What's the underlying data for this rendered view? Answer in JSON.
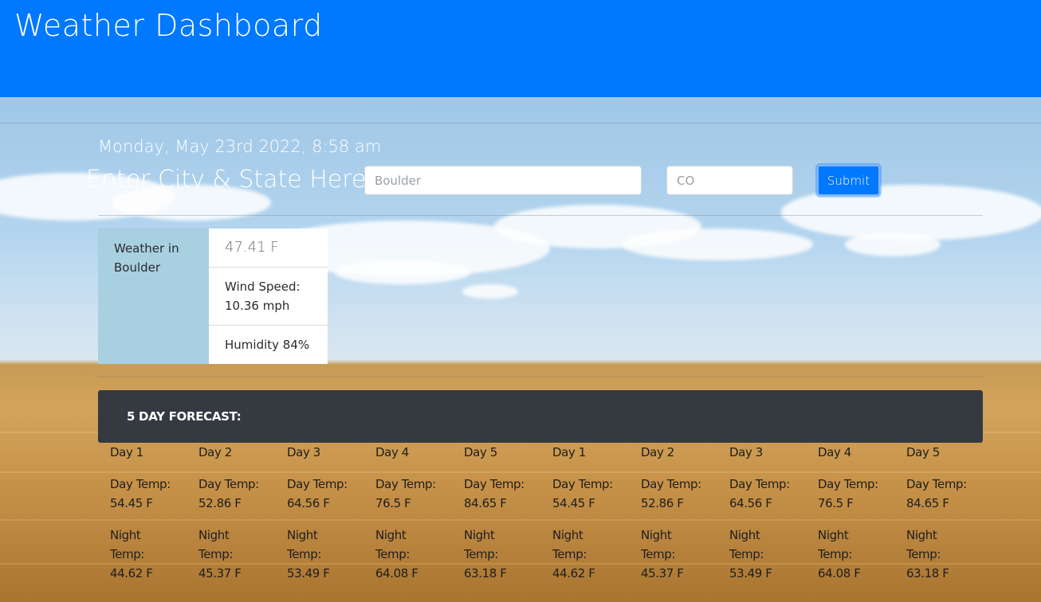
{
  "header": {
    "title": "Weather Dashboard"
  },
  "datetime": "Monday, May 23rd 2022, 8:58 am",
  "search": {
    "prompt": "Enter City & State Here:",
    "city_placeholder": "Boulder",
    "state_placeholder": "CO",
    "submit_label": "Submit"
  },
  "current": {
    "label": "Weather in Boulder",
    "temp": "47.41 F",
    "wind": "Wind Speed: 10.36 mph",
    "humidity": "Humidity 84%"
  },
  "forecast": {
    "title": "5 DAY FORECAST:",
    "days": [
      {
        "name": "Day 1",
        "day_temp": "Day Temp: 54.45 F",
        "night_temp": "Night Temp: 44.62 F"
      },
      {
        "name": "Day 2",
        "day_temp": "Day Temp: 52.86 F",
        "night_temp": "Night Temp: 45.37 F"
      },
      {
        "name": "Day 3",
        "day_temp": "Day Temp: 64.56 F",
        "night_temp": "Night Temp: 53.49 F"
      },
      {
        "name": "Day 4",
        "day_temp": "Day Temp: 76.5 F",
        "night_temp": "Night Temp: 64.08 F"
      },
      {
        "name": "Day 5",
        "day_temp": "Day Temp: 84.65 F",
        "night_temp": "Night Temp: 63.18 F"
      },
      {
        "name": "Day 1",
        "day_temp": "Day Temp: 54.45 F",
        "night_temp": "Night Temp: 44.62 F"
      },
      {
        "name": "Day 2",
        "day_temp": "Day Temp: 52.86 F",
        "night_temp": "Night Temp: 45.37 F"
      },
      {
        "name": "Day 3",
        "day_temp": "Day Temp: 64.56 F",
        "night_temp": "Night Temp: 53.49 F"
      },
      {
        "name": "Day 4",
        "day_temp": "Day Temp: 76.5 F",
        "night_temp": "Night Temp: 64.08 F"
      },
      {
        "name": "Day 5",
        "day_temp": "Day Temp: 84.65 F",
        "night_temp": "Night Temp: 63.18 F"
      }
    ]
  },
  "colors": {
    "header_bg": "#0078ff",
    "forecast_bar_bg": "#343a40",
    "current_label_bg": "#a8d0e0"
  }
}
